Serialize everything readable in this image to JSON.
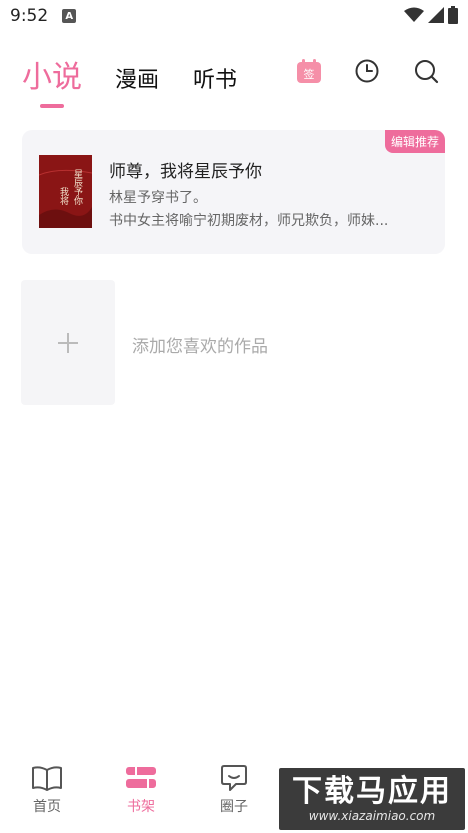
{
  "status_bar": {
    "time": "9:52",
    "notification_badge": "A"
  },
  "top_tabs": {
    "tabs": [
      "小说",
      "漫画",
      "听书"
    ],
    "active_index": 0,
    "sign_in_icon_text": "签"
  },
  "recommended": {
    "badge": "编辑推荐",
    "title": "师尊，我将星辰予你",
    "author_line": "林星予穿书了。",
    "description": "书中女主将喻宁初期废材，师兄欺负，师妹...",
    "cover_text_1": "星辰予你",
    "cover_text_2": "我将"
  },
  "add_works": {
    "label": "添加您喜欢的作品"
  },
  "bottom_nav": {
    "items": [
      {
        "label": "首页",
        "icon": "book-open-icon",
        "active": false
      },
      {
        "label": "书架",
        "icon": "bookshelf-icon",
        "active": true
      },
      {
        "label": "圈子",
        "icon": "chat-bubble-icon",
        "active": false
      }
    ]
  },
  "watermark": {
    "big": "下载马应用",
    "small": "www.xiazaimiao.com"
  },
  "colors": {
    "accent": "#ee6c9c",
    "card_bg": "#f5f5f8"
  }
}
